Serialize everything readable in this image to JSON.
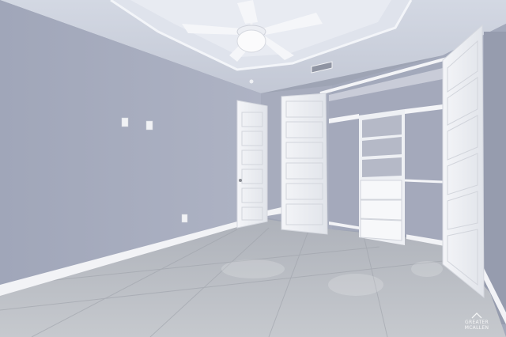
{
  "scene": {
    "watermark": {
      "line1": "GREATER MCALLEN"
    }
  }
}
